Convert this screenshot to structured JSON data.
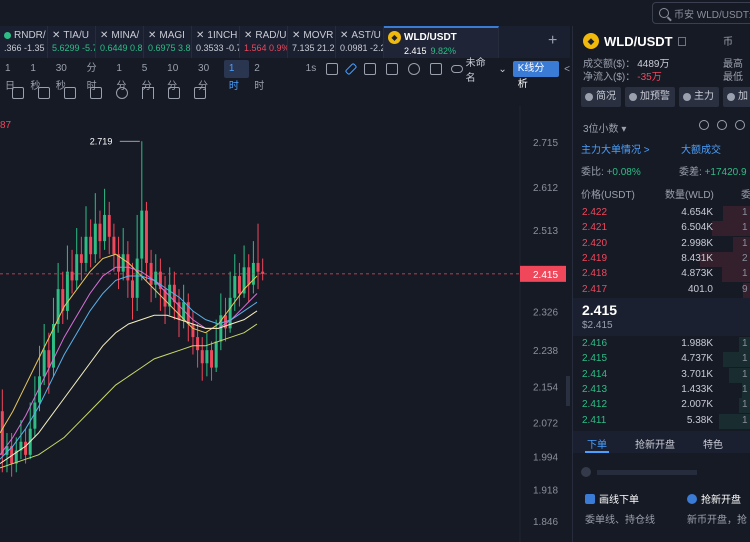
{
  "search": {
    "placeholder": "币安 WLD/USDT永"
  },
  "tabs": [
    {
      "name": "RNDR/",
      "value": ".366 -1.35",
      "color": "#c9ccd6",
      "closable": false
    },
    {
      "name": "TIA/U",
      "value": "5.6299 -5.7",
      "color": "#2ebd85",
      "closable": true
    },
    {
      "name": "MINA/",
      "value": "0.6449 0.8",
      "color": "#2ebd85",
      "closable": true
    },
    {
      "name": "MAGI",
      "value": "0.6975 3.8",
      "color": "#2ebd85",
      "closable": true
    },
    {
      "name": "1INCH",
      "value": "0.3533 -0.7",
      "color": "#c9ccd6",
      "closable": true
    },
    {
      "name": "RAD/U",
      "value": "1.564 0.9%",
      "color": "#f0475b",
      "closable": true
    },
    {
      "name": "MOVR",
      "value": "7.135 21.2",
      "color": "#c9ccd6",
      "closable": true
    },
    {
      "name": "AST/U",
      "value": "0.0981 -2.2",
      "color": "#c9ccd6",
      "closable": true
    }
  ],
  "active_tab": {
    "name": "WLD/USDT",
    "price": "2.415",
    "change": "9.82%",
    "price_color": "#ffffff",
    "change_color": "#2ebd85"
  },
  "add_tab": "+",
  "timeframes": [
    "1日",
    "1秒",
    "30秒",
    "分时",
    "1分",
    "5分",
    "10分",
    "30分",
    "1时",
    "2时"
  ],
  "selected_timeframe": "1时",
  "toolbar_extra": {
    "s1": "1s",
    "unnamed": "未命名",
    "kline_btn": "K线分析"
  },
  "chart_labels": {
    "peak": "2.719",
    "corner": "87",
    "current_price": "2.415"
  },
  "price_axis": [
    "2.715",
    "2.612",
    "2.513",
    "2.415",
    "2.326",
    "2.238",
    "2.154",
    "2.072",
    "1.994",
    "1.918",
    "1.846"
  ],
  "chart_data": {
    "type": "candlestick",
    "title": "",
    "ylim": [
      1.846,
      2.715
    ],
    "y_ticks": [
      2.715,
      2.612,
      2.513,
      2.415,
      2.326,
      2.238,
      2.154,
      2.072,
      1.994,
      1.918,
      1.846
    ],
    "current_price": 2.415,
    "peak_label": 2.719,
    "candles": [
      [
        2.1,
        2.0,
        2.15,
        1.96
      ],
      [
        2.0,
        2.02,
        2.05,
        1.96
      ],
      [
        2.02,
        1.98,
        2.05,
        1.95
      ],
      [
        1.98,
        2.01,
        2.04,
        1.96
      ],
      [
        2.01,
        2.03,
        2.08,
        1.99
      ],
      [
        2.03,
        2.0,
        2.06,
        1.98
      ],
      [
        2.0,
        2.06,
        2.12,
        1.99
      ],
      [
        2.06,
        2.12,
        2.18,
        2.04
      ],
      [
        2.12,
        2.18,
        2.25,
        2.1
      ],
      [
        2.18,
        2.24,
        2.3,
        2.16
      ],
      [
        2.24,
        2.2,
        2.28,
        2.14
      ],
      [
        2.2,
        2.3,
        2.36,
        2.18
      ],
      [
        2.3,
        2.38,
        2.44,
        2.28
      ],
      [
        2.38,
        2.33,
        2.42,
        2.3
      ],
      [
        2.33,
        2.42,
        2.48,
        2.31
      ],
      [
        2.42,
        2.4,
        2.47,
        2.37
      ],
      [
        2.4,
        2.46,
        2.52,
        2.38
      ],
      [
        2.46,
        2.44,
        2.5,
        2.4
      ],
      [
        2.44,
        2.5,
        2.57,
        2.42
      ],
      [
        2.5,
        2.46,
        2.54,
        2.43
      ],
      [
        2.46,
        2.53,
        2.6,
        2.44
      ],
      [
        2.53,
        2.49,
        2.56,
        2.45
      ],
      [
        2.49,
        2.55,
        2.61,
        2.47
      ],
      [
        2.55,
        2.5,
        2.58,
        2.46
      ],
      [
        2.5,
        2.46,
        2.53,
        2.42
      ],
      [
        2.46,
        2.42,
        2.5,
        2.38
      ],
      [
        2.42,
        2.46,
        2.52,
        2.4
      ],
      [
        2.46,
        2.4,
        2.49,
        2.36
      ],
      [
        2.4,
        2.36,
        2.44,
        2.31
      ],
      [
        2.36,
        2.45,
        2.55,
        2.33
      ],
      [
        2.45,
        2.56,
        2.719,
        2.4
      ],
      [
        2.56,
        2.44,
        2.58,
        2.4
      ],
      [
        2.44,
        2.39,
        2.47,
        2.35
      ],
      [
        2.39,
        2.42,
        2.46,
        2.36
      ],
      [
        2.42,
        2.38,
        2.45,
        2.33
      ],
      [
        2.38,
        2.34,
        2.41,
        2.3
      ],
      [
        2.34,
        2.39,
        2.43,
        2.32
      ],
      [
        2.39,
        2.35,
        2.42,
        2.31
      ],
      [
        2.35,
        2.31,
        2.38,
        2.27
      ],
      [
        2.31,
        2.35,
        2.39,
        2.29
      ],
      [
        2.35,
        2.3,
        2.37,
        2.26
      ],
      [
        2.3,
        2.27,
        2.33,
        2.23
      ],
      [
        2.27,
        2.24,
        2.3,
        2.2
      ],
      [
        2.24,
        2.21,
        2.27,
        2.17
      ],
      [
        2.21,
        2.24,
        2.28,
        2.18
      ],
      [
        2.24,
        2.2,
        2.26,
        2.17
      ],
      [
        2.2,
        2.26,
        2.31,
        2.19
      ],
      [
        2.26,
        2.32,
        2.37,
        2.24
      ],
      [
        2.32,
        2.29,
        2.36,
        2.26
      ],
      [
        2.29,
        2.36,
        2.42,
        2.28
      ],
      [
        2.36,
        2.41,
        2.46,
        2.33
      ],
      [
        2.41,
        2.37,
        2.44,
        2.34
      ],
      [
        2.37,
        2.43,
        2.48,
        2.36
      ],
      [
        2.43,
        2.39,
        2.46,
        2.35
      ],
      [
        2.39,
        2.44,
        2.49,
        2.37
      ],
      [
        2.44,
        2.42,
        2.53,
        2.38
      ],
      [
        2.42,
        2.415,
        2.45,
        2.4
      ]
    ],
    "moving_averages": [
      {
        "color": "#e8c65a",
        "values": [
          2.05,
          2.1,
          2.16,
          2.22,
          2.28,
          2.34,
          2.38,
          2.42,
          2.45,
          2.46,
          2.44,
          2.41,
          2.38,
          2.35,
          2.32,
          2.29,
          2.28,
          2.3,
          2.34,
          2.38,
          2.41
        ]
      },
      {
        "color": "#d86fd8",
        "values": [
          2.0,
          2.04,
          2.09,
          2.15,
          2.21,
          2.27,
          2.32,
          2.37,
          2.41,
          2.43,
          2.43,
          2.42,
          2.4,
          2.37,
          2.34,
          2.31,
          2.29,
          2.29,
          2.31,
          2.34,
          2.37
        ]
      },
      {
        "color": "#5ab0e8",
        "values": [
          1.99,
          2.02,
          2.06,
          2.11,
          2.17,
          2.23,
          2.28,
          2.33,
          2.37,
          2.4,
          2.41,
          2.41,
          2.4,
          2.38,
          2.36,
          2.33,
          2.31,
          2.3,
          2.31,
          2.33,
          2.35
        ]
      },
      {
        "color": "#f5f0c0",
        "values": [
          1.98,
          2.0,
          2.02,
          2.05,
          2.09,
          2.13,
          2.17,
          2.21,
          2.25,
          2.28,
          2.3,
          2.31,
          2.32,
          2.32,
          2.31,
          2.3,
          2.29,
          2.29,
          2.3,
          2.31,
          2.33
        ]
      },
      {
        "color": "#c8d86a",
        "values": [
          1.97,
          1.98,
          1.99,
          2.0,
          2.02,
          2.04,
          2.07,
          2.1,
          2.13,
          2.16,
          2.18,
          2.2,
          2.22,
          2.23,
          2.24,
          2.25,
          2.25,
          2.26,
          2.27,
          2.28,
          2.3
        ]
      }
    ]
  },
  "right_panel": {
    "pair": "WLD/USDT",
    "volume_label": "成交额($)：",
    "volume_value": "4489万",
    "netflow_label": "净流入($)：",
    "netflow_value": "-35万",
    "high_label": "最高",
    "low_label": "最低",
    "right_hint": "币",
    "buttons": [
      "简况",
      "加预警",
      "主力",
      "加"
    ],
    "decimals": "3位小数",
    "main_force": "主力大单情况 >",
    "big_trades": "大额成交",
    "weibi_label": "委比:",
    "weibi_value": "+0.08%",
    "weicha_label": "委差:",
    "weicha_value": "+17420.9",
    "col_price": "价格(USDT)",
    "col_qty": "数量(WLD)",
    "col_extra": "委",
    "asks": [
      {
        "price": "2.422",
        "qty": "4.654K",
        "extra": "1"
      },
      {
        "price": "2.421",
        "qty": "6.504K",
        "extra": "1"
      },
      {
        "price": "2.420",
        "qty": "2.998K",
        "extra": "1"
      },
      {
        "price": "2.419",
        "qty": "8.431K",
        "extra": "2"
      },
      {
        "price": "2.418",
        "qty": "4.873K",
        "extra": "1"
      },
      {
        "price": "2.417",
        "qty": "401.0",
        "extra": "9"
      }
    ],
    "mid_price": "2.415",
    "mid_usd": "$2.415",
    "bids": [
      {
        "price": "2.416",
        "qty": "1.988K",
        "extra": "1"
      },
      {
        "price": "2.415",
        "qty": "4.737K",
        "extra": "1"
      },
      {
        "price": "2.414",
        "qty": "3.701K",
        "extra": "1"
      },
      {
        "price": "2.413",
        "qty": "1.433K",
        "extra": "1"
      },
      {
        "price": "2.412",
        "qty": "2.007K",
        "extra": "1"
      },
      {
        "price": "2.411",
        "qty": "5.38K",
        "extra": "1"
      }
    ],
    "order_tabs": [
      "下单",
      "抢新开盘",
      "特色"
    ],
    "feature1_title": "画线下单",
    "feature1_desc": "委单线、持仓线",
    "feature2_title": "抢新开盘",
    "feature2_desc": "新币开盘，抢"
  }
}
